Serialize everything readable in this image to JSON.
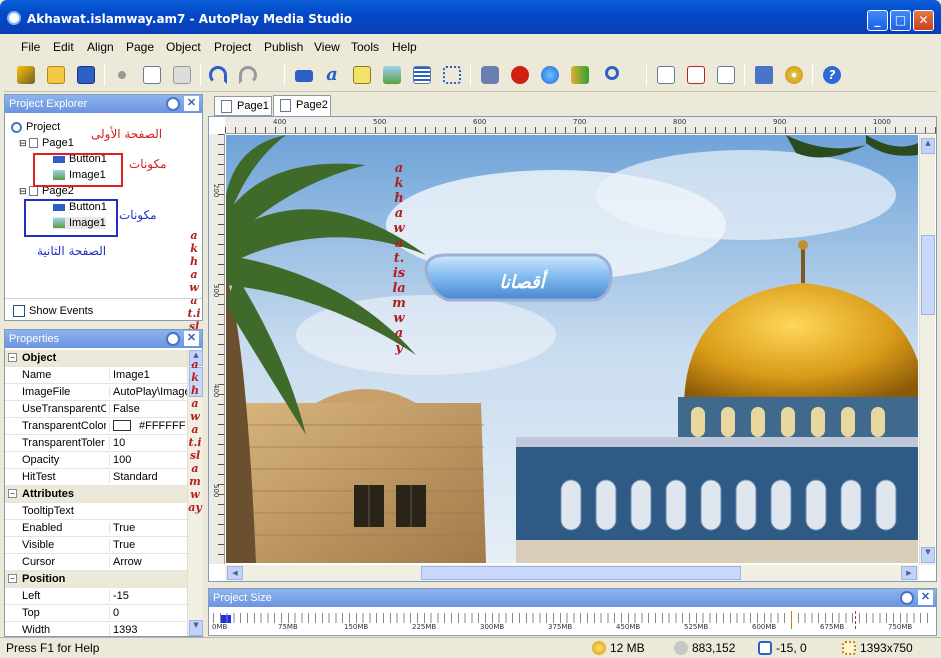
{
  "window": {
    "title": "Akhawat.islamway.am7 - AutoPlay Media Studio",
    "min": "_",
    "max": "□",
    "close": "✕"
  },
  "menu": [
    "File",
    "Edit",
    "Align",
    "Page",
    "Object",
    "Project",
    "Publish",
    "View",
    "Tools",
    "Help"
  ],
  "project_explorer": {
    "title": "Project Explorer",
    "nodes": {
      "root": "Project",
      "page1": "Page1",
      "btn1": "Button1",
      "img1": "Image1",
      "page2": "Page2",
      "btn2": "Button1",
      "img2": "Image1"
    },
    "annotations": {
      "first_page": "الصفحة الأولى",
      "components_1": "مكونات",
      "components_2": "مكونات",
      "second_page": "الصفحة الثانية"
    },
    "show_events": "Show Events"
  },
  "properties": {
    "title": "Properties",
    "rows": [
      {
        "k": "Object",
        "v": "",
        "cat": true
      },
      {
        "k": "Name",
        "v": "Image1"
      },
      {
        "k": "ImageFile",
        "v": "AutoPlay\\Image"
      },
      {
        "k": "UseTransparentC",
        "v": "False"
      },
      {
        "k": "TransparentColor",
        "v": "#FFFFFF"
      },
      {
        "k": "TransparentToler",
        "v": "10"
      },
      {
        "k": "Opacity",
        "v": "100"
      },
      {
        "k": "HitTest",
        "v": "Standard"
      },
      {
        "k": "Attributes",
        "v": "",
        "cat": true
      },
      {
        "k": "TooltipText",
        "v": ""
      },
      {
        "k": "Enabled",
        "v": "True"
      },
      {
        "k": "Visible",
        "v": "True"
      },
      {
        "k": "Cursor",
        "v": "Arrow"
      },
      {
        "k": "Position",
        "v": "",
        "cat": true
      },
      {
        "k": "Left",
        "v": "-15"
      },
      {
        "k": "Top",
        "v": "0"
      },
      {
        "k": "Width",
        "v": "1393"
      }
    ]
  },
  "tabs": [
    "Page1",
    "Page2"
  ],
  "ruler": {
    "h": [
      "400",
      "500",
      "600",
      "700",
      "800",
      "900",
      "1000"
    ],
    "v": [
      "200",
      "300",
      "400",
      "500"
    ]
  },
  "stage": {
    "button_text": "أقصانا",
    "watermark": "akhawat.islamway"
  },
  "project_size": {
    "title": "Project Size",
    "ticks": [
      "0MB",
      "75MB",
      "150MB",
      "225MB",
      "300MB",
      "375MB",
      "450MB",
      "525MB",
      "600MB",
      "675MB",
      "750MB"
    ]
  },
  "status": {
    "help": "Press F1 for Help",
    "size": "12 MB",
    "disk": "883,152",
    "pos": "-15, 0",
    "dims": "1393x750"
  },
  "colors": {
    "title_blue": "#0349c8",
    "panel_head": "#7ba2e8",
    "red_box": "#e02020",
    "blue_box": "#2030c0"
  }
}
